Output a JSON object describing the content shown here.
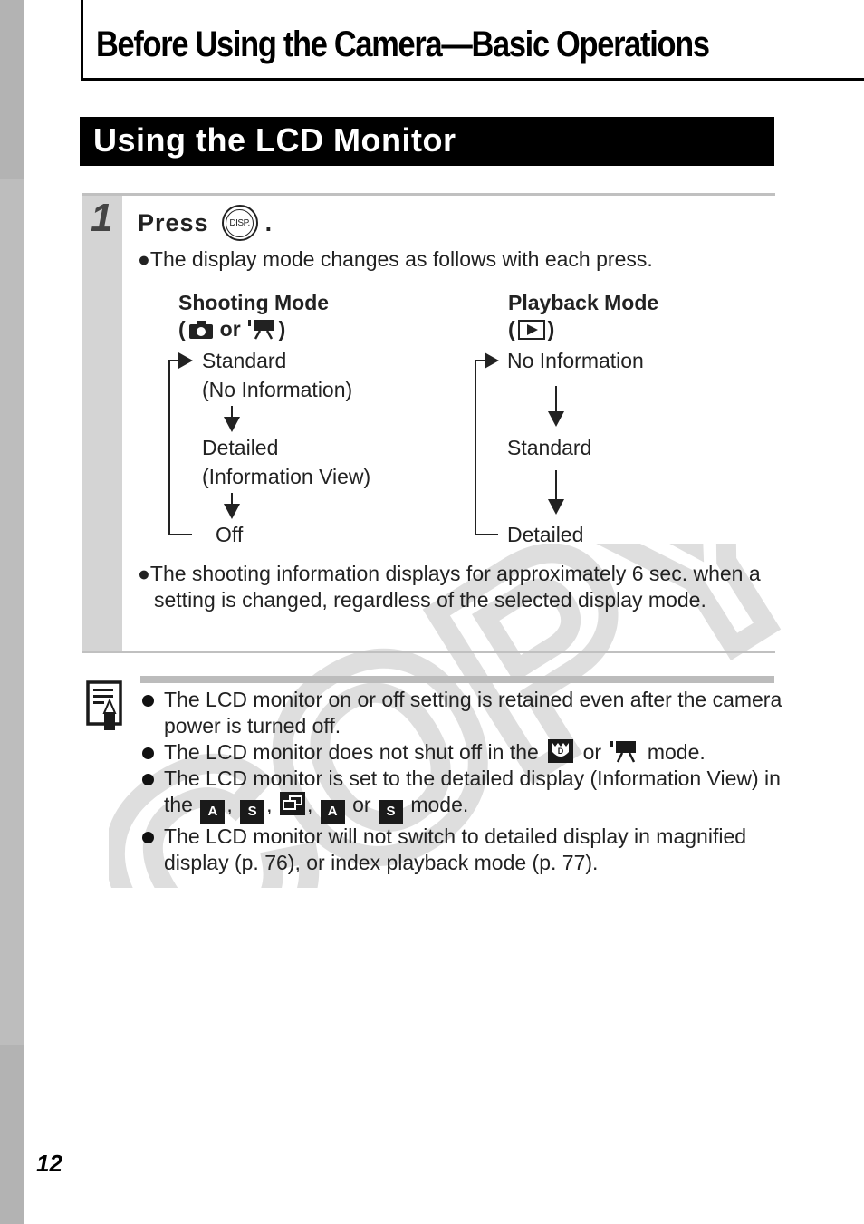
{
  "chapter": {
    "title": "Before Using the Camera—Basic Operations"
  },
  "section": {
    "title": "Using the LCD Monitor"
  },
  "step": {
    "number": "1",
    "press_label": "Press",
    "button_label": "DISP.",
    "press_suffix": ".",
    "intro_bullet": "The display mode changes as follows with each press.",
    "shooting": {
      "heading": "Shooting Mode",
      "modes_open": "(",
      "modes_or": "or",
      "modes_close": ")",
      "flow": [
        "Standard",
        "(No Information)",
        "Detailed",
        "(Information View)",
        "Off"
      ]
    },
    "playback": {
      "heading": "Playback Mode",
      "modes_open": "(",
      "modes_close": ")",
      "flow": [
        "No Information",
        "Standard",
        "Detailed"
      ]
    },
    "note_bullet": "The shooting information displays for approximately 6 sec. when a setting is changed, regardless of the selected display mode."
  },
  "notes": {
    "items": [
      {
        "text": "The LCD monitor on or off setting is retained even after the camera power is turned off."
      },
      {
        "text_before": "The LCD monitor does not shut off in the",
        "text_or": "or",
        "text_after": "mode."
      },
      {
        "text_before": "The LCD monitor is set to the detailed display (Information View) in the",
        "sep": ",",
        "text_or": "or",
        "text_after": "mode.",
        "icons": [
          "stitch-assist-A-icon",
          "stitch-assist-S-icon",
          "sequence-icon",
          "movie-stitch-A-icon",
          "movie-stitch-S-icon"
        ],
        "icon_labels": [
          "A",
          "S",
          "",
          "A",
          "S"
        ]
      },
      {
        "text": "The LCD monitor will not switch to detailed display in magnified display (p. 76), or index playback mode (p. 77)."
      }
    ]
  },
  "watermark": {
    "text": "COPY"
  },
  "page_number": "12",
  "colors": {
    "sidebar_dark": "#b3b3b3",
    "sidebar_light": "#bdbdbd",
    "step_gutter": "#d4d4d4",
    "rule": "#c0c0c0",
    "watermark": "#d9d9d9"
  }
}
